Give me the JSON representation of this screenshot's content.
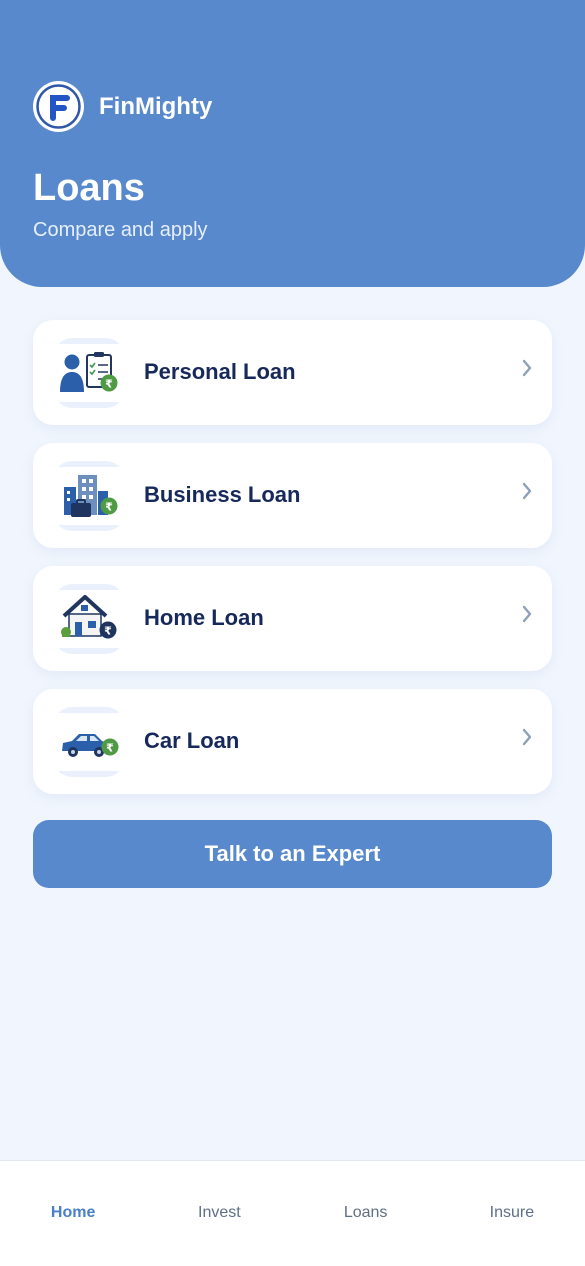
{
  "brand": {
    "name": "FinMighty",
    "logo_icon": "f-monogram-logo"
  },
  "page": {
    "title": "Loans",
    "subtitle": "Compare and apply"
  },
  "loans": [
    {
      "label": "Personal Loan",
      "icon": "personal-loan-icon"
    },
    {
      "label": "Business Loan",
      "icon": "business-loan-icon"
    },
    {
      "label": "Home Loan",
      "icon": "home-loan-icon"
    },
    {
      "label": "Car Loan",
      "icon": "car-loan-icon"
    }
  ],
  "cta": {
    "label": "Talk to an Expert"
  },
  "bottom_nav": [
    {
      "label": "Home",
      "active": true
    },
    {
      "label": "Invest",
      "active": false
    },
    {
      "label": "Loans",
      "active": false
    },
    {
      "label": "Insure",
      "active": false
    }
  ],
  "colors": {
    "header": "#5789cc",
    "background": "#f1f6fe",
    "card_text": "#17285a",
    "rupee_badge": "#4f9a45",
    "nav_active": "#4a7fca"
  }
}
